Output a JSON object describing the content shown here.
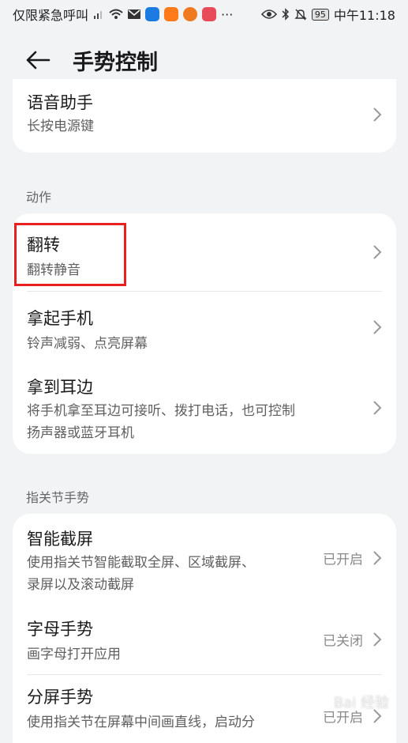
{
  "status": {
    "carrier": "仅限紧急呼叫",
    "battery": "95",
    "time": "中午11:18",
    "icons": [
      "signal-icon",
      "wifi-icon",
      "mail-icon",
      "app-shield-icon",
      "app-home-icon",
      "app-pumpkin-icon",
      "app-chat-icon",
      "more-icon",
      "eye-icon",
      "bluetooth-icon",
      "mute-icon"
    ]
  },
  "header": {
    "title": "手势控制"
  },
  "card1": {
    "items": [
      {
        "title": "语音助手",
        "sub": "长按电源键"
      }
    ]
  },
  "section_actions": "动作",
  "actions": [
    {
      "title": "翻转",
      "sub": "翻转静音"
    },
    {
      "title": "拿起手机",
      "sub": "铃声减弱、点亮屏幕"
    },
    {
      "title": "拿到耳边",
      "sub1": "将手机拿至耳边可接听、拨打电话，也可控制",
      "sub2": "扬声器或蓝牙耳机"
    }
  ],
  "section_knuckle": "指关节手势",
  "knuckle": [
    {
      "title": "智能截屏",
      "sub1": "使用指关节智能截取全屏、区域截屏、",
      "sub2": "录屏以及滚动截屏",
      "state": "已开启"
    },
    {
      "title": "字母手势",
      "sub": "画字母打开应用",
      "state": "已关闭"
    },
    {
      "title": "分屏手势",
      "sub": "使用指关节在屏幕中间画直线，启动分",
      "state": "已开启"
    }
  ],
  "watermark": "Bai 经验",
  "colors": {
    "highlight": "#e8201f",
    "background": "#f1f3f5",
    "card": "#ffffff"
  }
}
